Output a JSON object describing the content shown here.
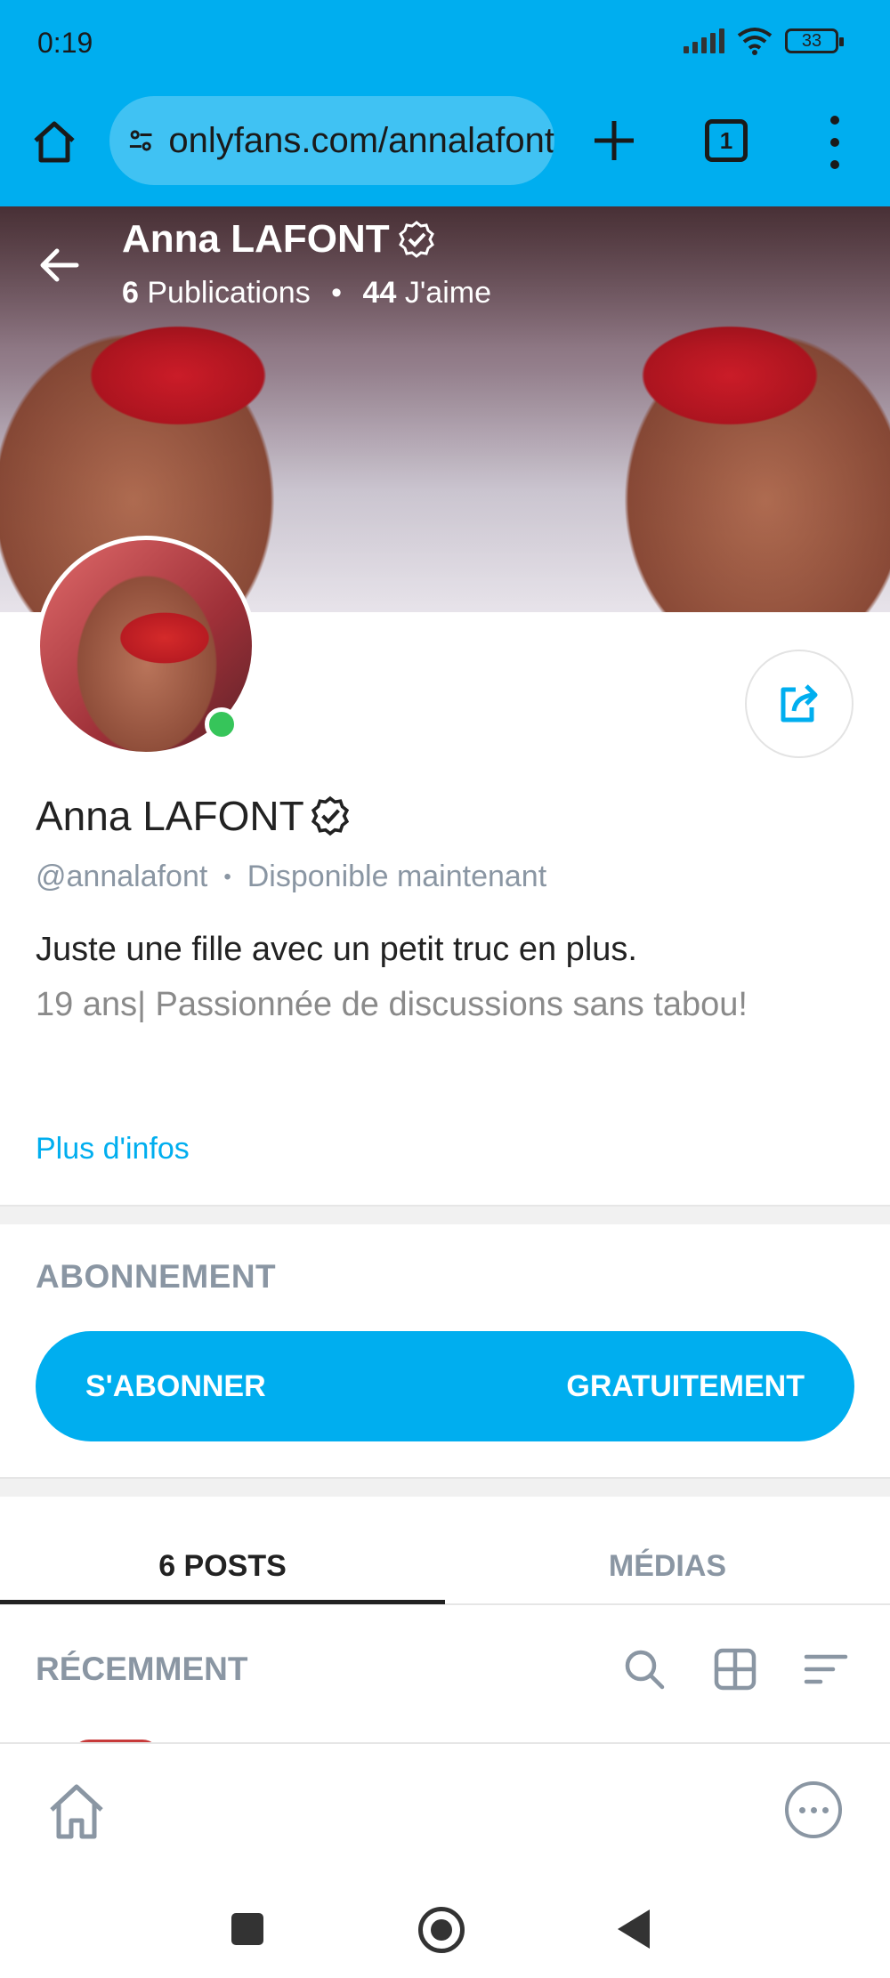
{
  "status_bar": {
    "time": "0:19",
    "battery": "33"
  },
  "browser": {
    "url": "onlyfans.com/annalafont",
    "tab_count": "1"
  },
  "profile": {
    "name": "Anna LAFONT",
    "posts_count": "6",
    "posts_label": "Publications",
    "likes_count": "44",
    "likes_label": "J'aime",
    "handle": "@annalafont",
    "availability": "Disponible maintenant",
    "bio_line1": "Juste une fille avec un petit truc en plus.",
    "bio_line2": "19 ans| Passionnée de discussions sans tabou!",
    "more_info": "Plus d'infos"
  },
  "subscription": {
    "title": "ABONNEMENT",
    "button_left": "S'ABONNER",
    "button_right": "GRATUITEMENT"
  },
  "tabs": [
    {
      "label": "6 POSTS",
      "active": true
    },
    {
      "label": "MÉDIAS",
      "active": false
    }
  ],
  "feed": {
    "sort_label": "RÉCEMMENT"
  },
  "icons": {
    "home": "home-icon",
    "site_settings": "tune-icon",
    "new_tab": "plus-icon",
    "tabs": "tabs-icon",
    "menu": "more-vert-icon",
    "back": "arrow-left-icon",
    "verified": "verified-badge-icon",
    "share": "share-icon",
    "search": "search-icon",
    "grid": "grid-icon",
    "sort": "sort-icon",
    "more": "more-horiz-icon"
  },
  "colors": {
    "brand": "#00aeef",
    "muted": "#8a96a3",
    "online": "#36c55a"
  }
}
